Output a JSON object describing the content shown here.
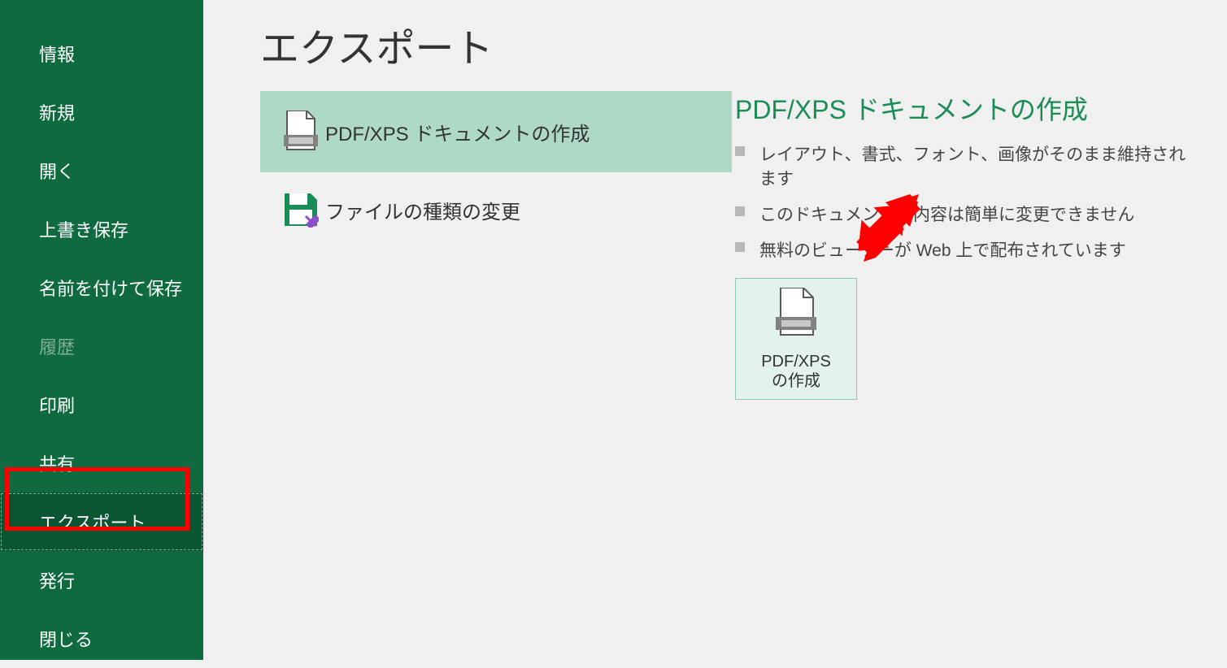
{
  "sidebar": {
    "items": [
      {
        "label": "情報"
      },
      {
        "label": "新規"
      },
      {
        "label": "開く"
      },
      {
        "label": "上書き保存"
      },
      {
        "label": "名前を付けて保存"
      },
      {
        "label": "履歴"
      },
      {
        "label": "印刷"
      },
      {
        "label": "共有"
      },
      {
        "label": "エクスポート"
      },
      {
        "label": "発行"
      },
      {
        "label": "閉じる"
      }
    ]
  },
  "main": {
    "title": "エクスポート",
    "options": [
      {
        "label": "PDF/XPS ドキュメントの作成",
        "selected": true,
        "icon": "pdf-document-icon"
      },
      {
        "label": "ファイルの種類の変更",
        "selected": false,
        "icon": "save-as-icon"
      }
    ]
  },
  "detail": {
    "title": "PDF/XPS ドキュメントの作成",
    "bullets": [
      "レイアウト、書式、フォント、画像がそのまま維持されます",
      "このドキュメントの内容は簡単に変更できません",
      "無料のビューアーが Web 上で配布されています"
    ],
    "button_label_line1": "PDF/XPS",
    "button_label_line2": "の作成"
  },
  "annotations": {
    "highlight": "sidebar-item-export",
    "arrow_target": "create-pdf-xps-button",
    "arrow_color": "#ff0000"
  },
  "colors": {
    "sidebar_bg": "#0f6b3f",
    "accent_green": "#1a8c56",
    "selected_option_bg": "#aed9c5"
  }
}
